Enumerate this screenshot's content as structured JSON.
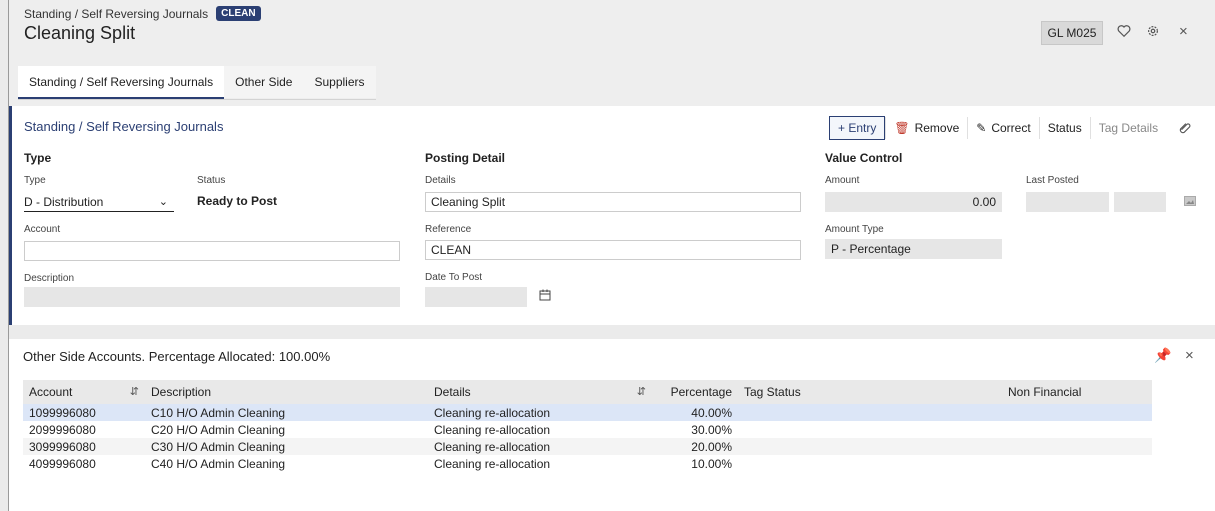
{
  "header": {
    "breadcrumb": "Standing / Self Reversing Journals",
    "badge": "CLEAN",
    "title": "Cleaning Split",
    "program_code": "GL M025",
    "icons": [
      "heart-icon",
      "gear-icon",
      "close-icon"
    ]
  },
  "tabs": [
    "Standing / Self Reversing Journals",
    "Other Side",
    "Suppliers"
  ],
  "section": {
    "title": "Standing / Self Reversing Journals",
    "toolbar": {
      "entry": "+ Entry",
      "remove": "Remove",
      "correct": "Correct",
      "status": "Status",
      "tag_details": "Tag Details"
    },
    "type_group": {
      "heading": "Type",
      "type_label": "Type",
      "type_value": "D - Distribution",
      "status_label": "Status",
      "status_value": "Ready to Post",
      "account_label": "Account",
      "account_value": "",
      "description_label": "Description",
      "description_value": ""
    },
    "posting_group": {
      "heading": "Posting Detail",
      "details_label": "Details",
      "details_value": "Cleaning Split",
      "reference_label": "Reference",
      "reference_value": "CLEAN",
      "date_label": "Date To Post",
      "date_value": ""
    },
    "value_group": {
      "heading": "Value Control",
      "amount_label": "Amount",
      "amount_value": "0.00",
      "last_posted_label": "Last Posted",
      "amount_type_label": "Amount Type",
      "amount_type_value": "P - Percentage"
    }
  },
  "grid": {
    "title": "Other Side Accounts.  Percentage Allocated: 100.00%",
    "columns": [
      "Account",
      "Description",
      "Details",
      "Percentage",
      "Tag Status",
      "Non Financial"
    ],
    "rows": [
      {
        "account": "1099996080",
        "description": "C10 H/O Admin Cleaning",
        "details": "Cleaning re-allocation",
        "percentage": "40.00%",
        "tag_status": "",
        "non_financial": ""
      },
      {
        "account": "2099996080",
        "description": "C20 H/O Admin Cleaning",
        "details": "Cleaning re-allocation",
        "percentage": "30.00%",
        "tag_status": "",
        "non_financial": ""
      },
      {
        "account": "3099996080",
        "description": "C30 H/O Admin Cleaning",
        "details": "Cleaning re-allocation",
        "percentage": "20.00%",
        "tag_status": "",
        "non_financial": ""
      },
      {
        "account": "4099996080",
        "description": "C40 H/O Admin Cleaning",
        "details": "Cleaning re-allocation",
        "percentage": "10.00%",
        "tag_status": "",
        "non_financial": ""
      }
    ]
  }
}
